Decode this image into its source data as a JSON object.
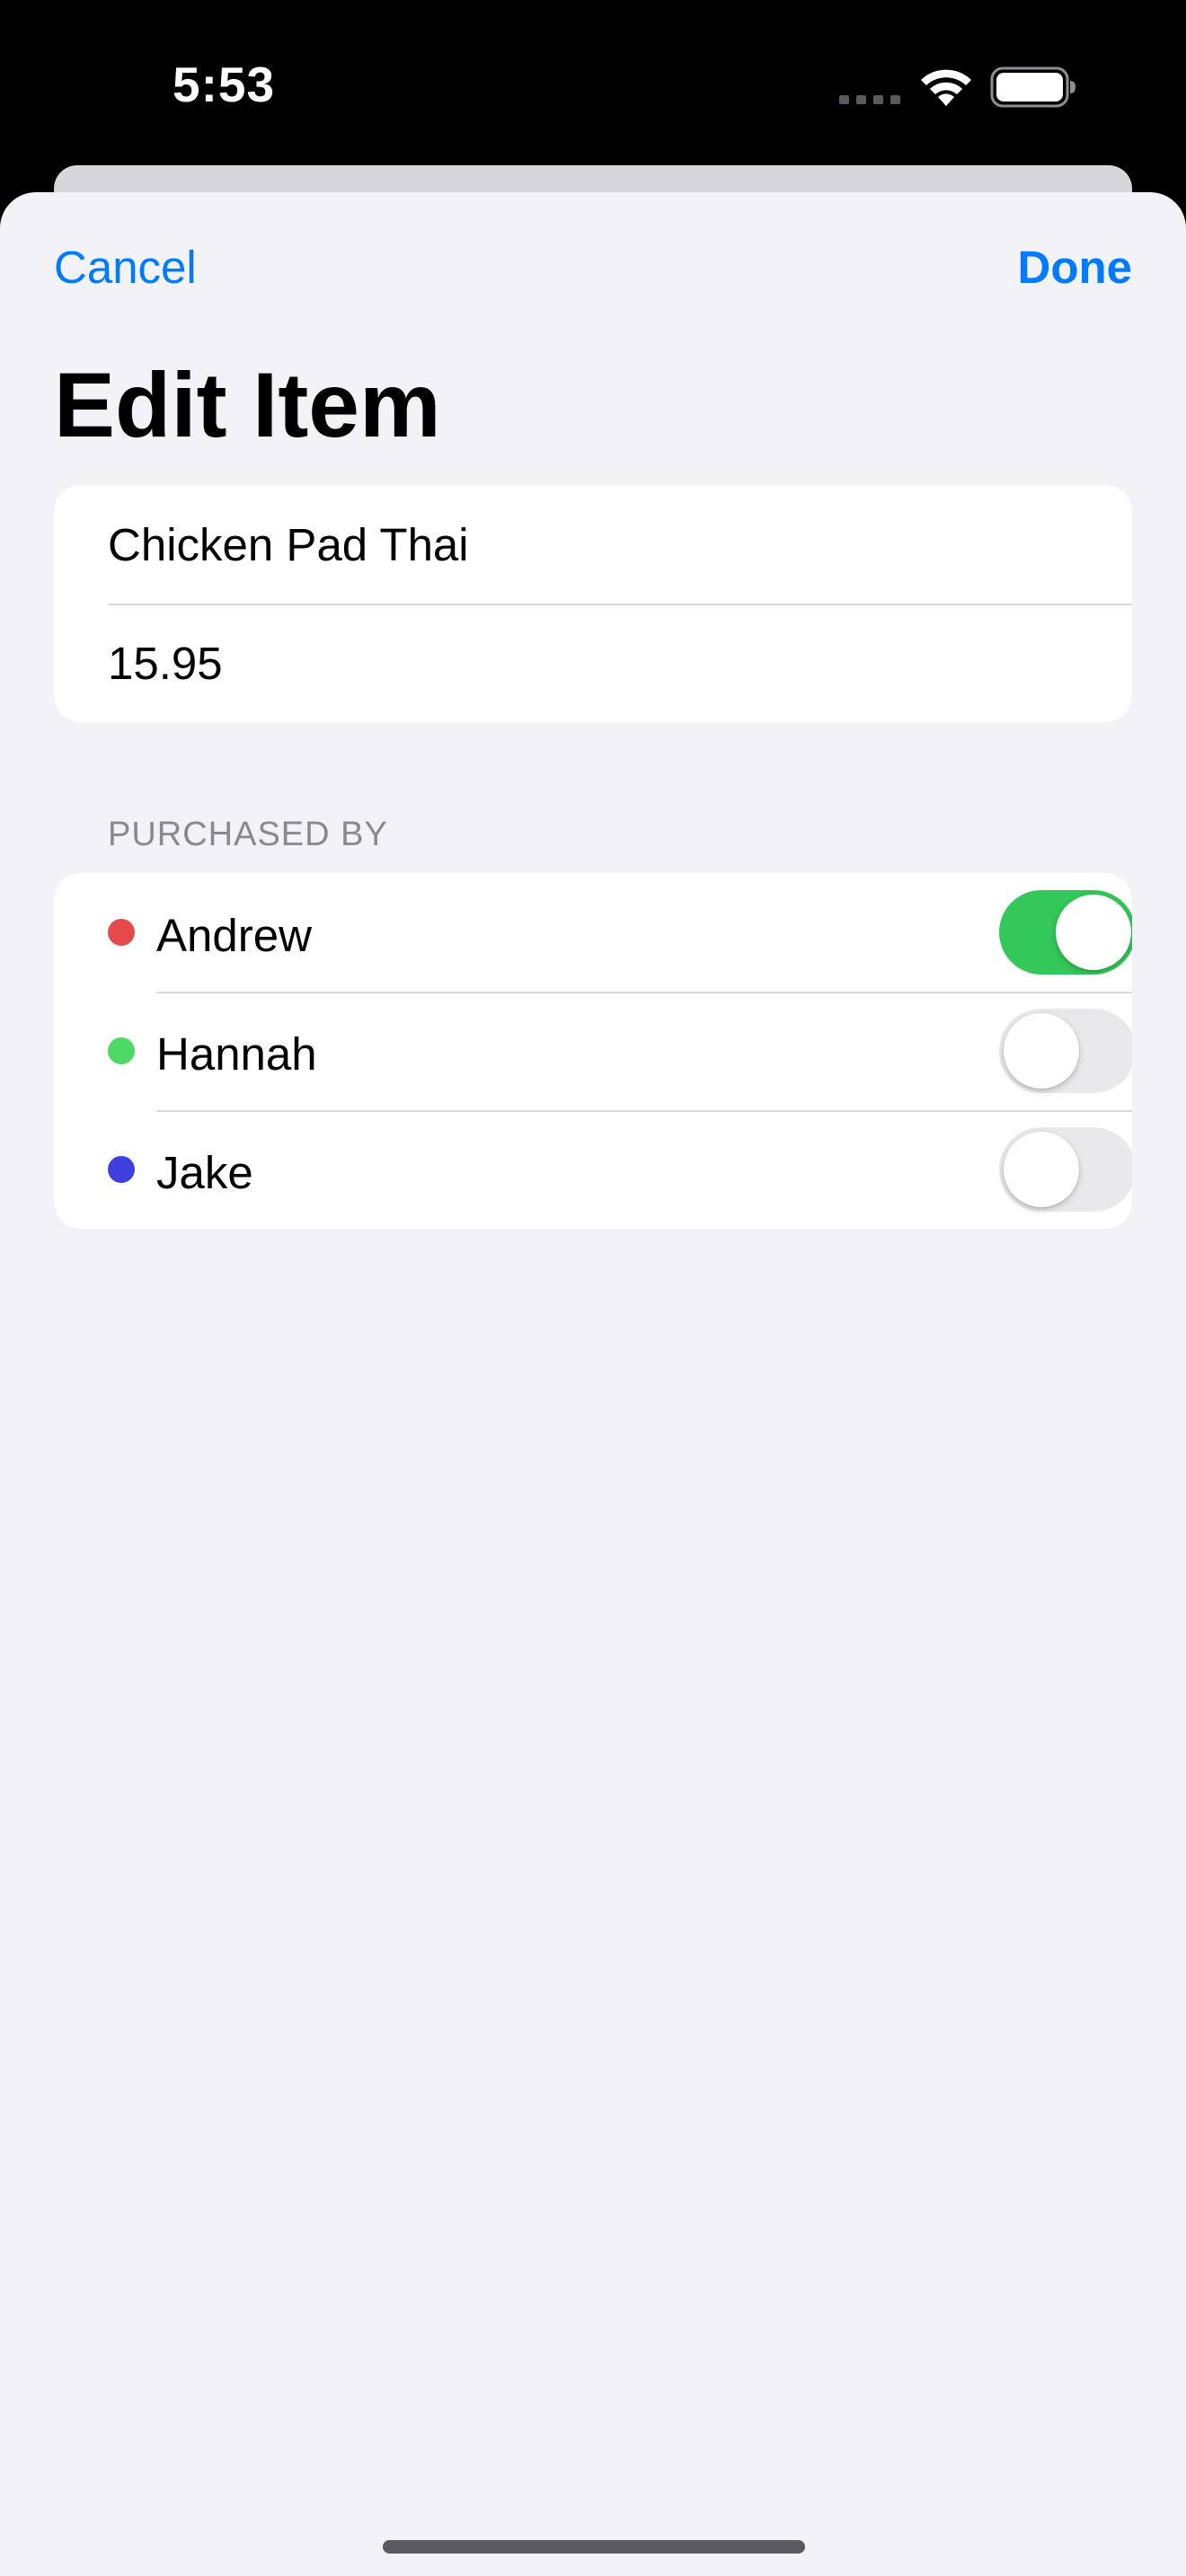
{
  "status_bar": {
    "time": "5:53"
  },
  "nav": {
    "cancel_label": "Cancel",
    "done_label": "Done"
  },
  "page": {
    "title": "Edit Item"
  },
  "item": {
    "name": "Chicken Pad Thai",
    "price": "15.95"
  },
  "purchased_by": {
    "header": "PURCHASED BY",
    "people": [
      {
        "name": "Andrew",
        "color": "#e5484d",
        "selected": true
      },
      {
        "name": "Hannah",
        "color": "#4cd964",
        "selected": false
      },
      {
        "name": "Jake",
        "color": "#3f3fe0",
        "selected": false
      }
    ]
  },
  "colors": {
    "accent": "#007aff",
    "toggle_on": "#34c759"
  }
}
